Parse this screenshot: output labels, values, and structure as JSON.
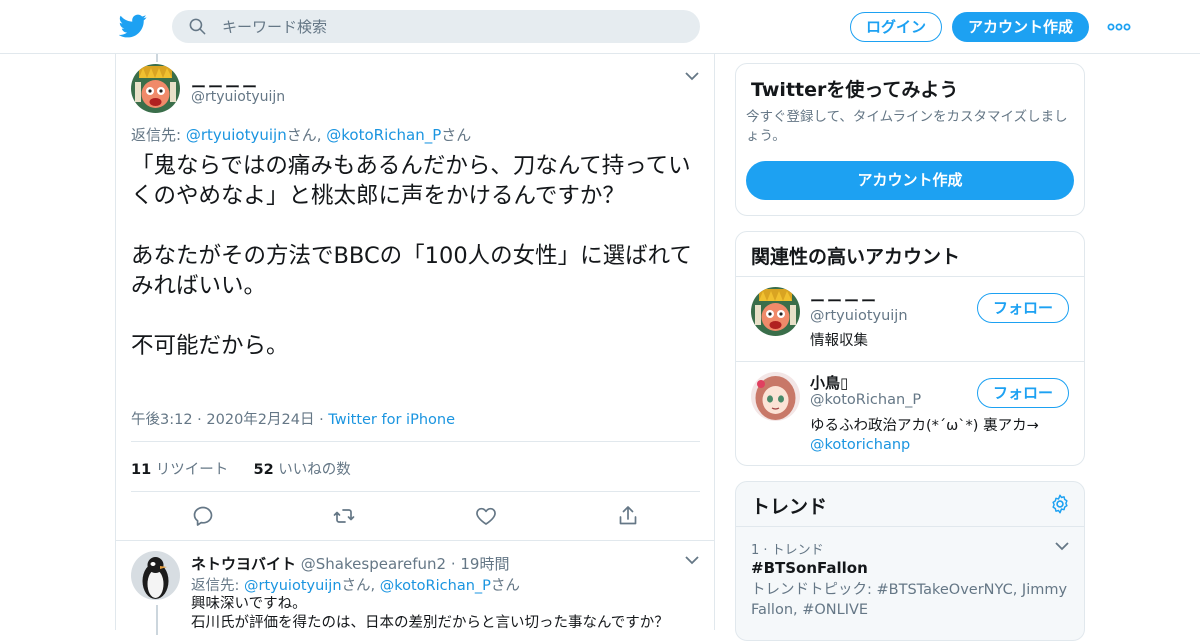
{
  "header": {
    "search_placeholder": "キーワード検索",
    "login_label": "ログイン",
    "signup_label": "アカウント作成",
    "brand_color": "#1da1f2"
  },
  "tweet": {
    "display_name": "ーーーー",
    "handle": "@rtyuiotyuijn",
    "reply_prefix": "返信先: ",
    "reply_to_1": "@rtyuiotyuijn",
    "reply_san_1": "さん, ",
    "reply_to_2": "@kotoRichan_P",
    "reply_san_2": "さん",
    "text": "「鬼ならではの痛みもあるんだから、刀なんて持っていくのやめなよ」と桃太郎に声をかけるんですか？\n\nあなたがその方法でBBCの「100人の女性」に選ばれてみればいい。\n\n不可能だから。",
    "timestamp": "午後3:12 · 2020年2月24日 · ",
    "source": "Twitter for iPhone",
    "retweet_count": "11",
    "retweet_label": " リツイート",
    "like_count": "52",
    "like_label": " いいねの数"
  },
  "reply": {
    "display_name": "ネトウヨバイト",
    "handle": " @Shakespearefun2",
    "time": " · 19時間",
    "reply_prefix": "返信先: ",
    "reply_to_1": "@rtyuiotyuijn",
    "reply_san_1": "さん, ",
    "reply_to_2": "@kotoRichan_P",
    "reply_san_2": "さん",
    "text": "興味深いですね。\n石川氏が評価を得たのは、日本の差別だからと言い切った事なんですか？"
  },
  "signup_card": {
    "title": "Twitterを使ってみよう",
    "subtitle": "今すぐ登録して、タイムラインをカスタマイズしましょう。",
    "button": "アカウント作成"
  },
  "related": {
    "title": "関連性の高いアカウント",
    "accounts": [
      {
        "name": "ーーーー",
        "handle": "@rtyuiotyuijn",
        "bio": "情報収集",
        "follow": "フォロー"
      },
      {
        "name": "小鳥▯",
        "handle": "@kotoRichan_P",
        "bio": "ゆるふわ政治アカ(*´ω`*) 裏アカ→",
        "bio_link": "@kotorichanp",
        "follow": "フォロー"
      }
    ]
  },
  "trends": {
    "title": "トレンド",
    "items": [
      {
        "meta": "1 · トレンド",
        "name": "#BTSonFallon",
        "topic": "トレンドトピック: #BTSTakeOverNYC, Jimmy Fallon, #ONLIVE"
      }
    ]
  }
}
